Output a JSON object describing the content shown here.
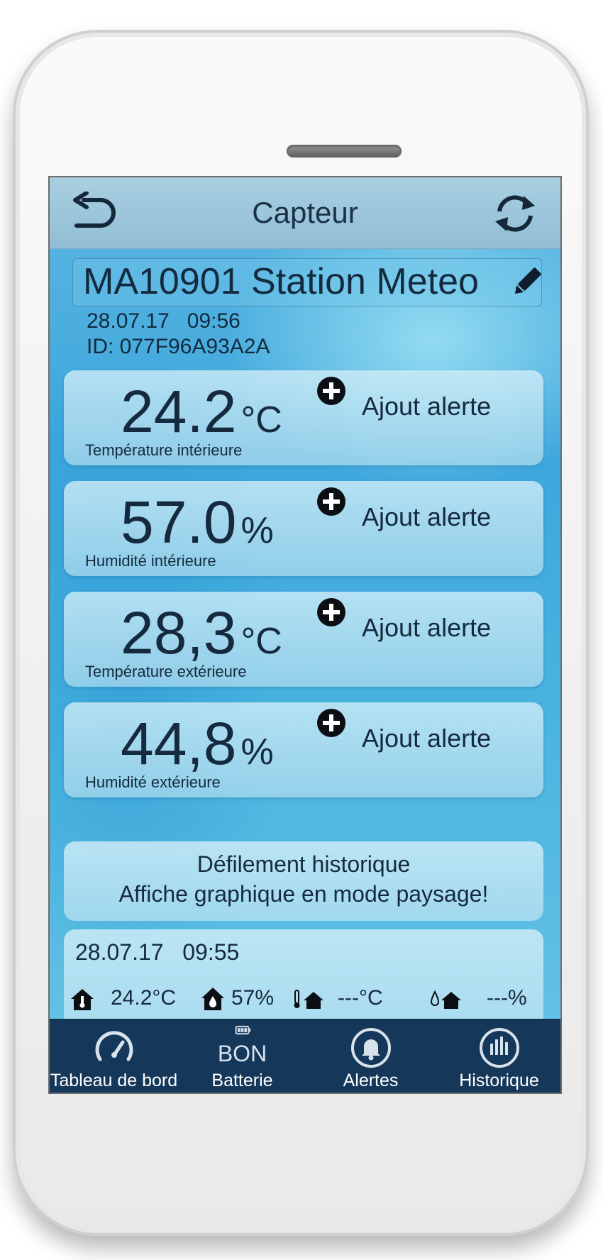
{
  "header": {
    "title": "Capteur"
  },
  "sensor": {
    "name": "MA10901 Station Meteo",
    "date": "28.07.17",
    "time": "09:56",
    "id": "ID: 077F96A93A2A"
  },
  "readings": [
    {
      "value": "24.2",
      "unit": "°C",
      "label": "Température intérieure",
      "alert_label": "Ajout alerte"
    },
    {
      "value": "57.0",
      "unit": "%",
      "label": "Humidité intérieure",
      "alert_label": "Ajout alerte"
    },
    {
      "value": "28,3",
      "unit": "°C",
      "label": "Température extérieure",
      "alert_label": "Ajout alerte"
    },
    {
      "value": "44,8",
      "unit": "%",
      "label": "Humidité extérieure",
      "alert_label": "Ajout alerte"
    }
  ],
  "history_notice": {
    "line1": "Défilement historique",
    "line2": "Affiche graphique en mode paysage!"
  },
  "history_row": {
    "date": "28.07.17",
    "time": "09:55",
    "indoor_temp": "24.2°C",
    "indoor_hum": "57%",
    "outdoor_temp": "---°C",
    "outdoor_hum": "---%"
  },
  "tabs": {
    "dashboard": "Tableau de bord",
    "battery": "Batterie",
    "battery_status": "BON",
    "alerts": "Alertes",
    "history": "Historique"
  },
  "colors": {
    "tabbar": "#15375a",
    "text_dark": "#152a3e",
    "navbar": "#a9cfe1"
  }
}
